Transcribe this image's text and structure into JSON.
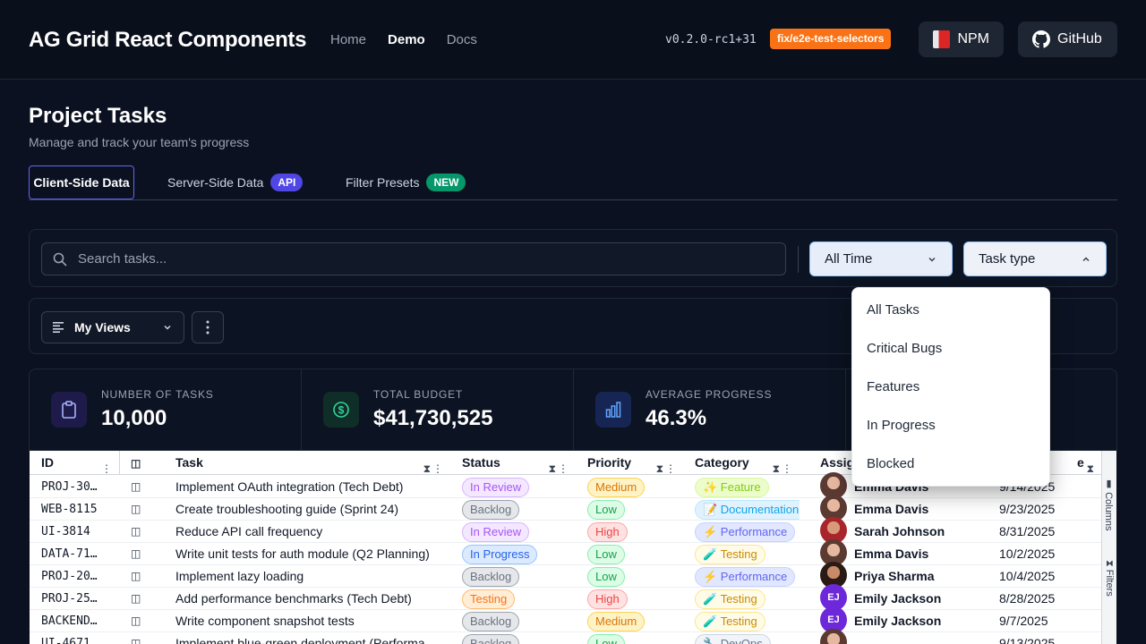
{
  "header": {
    "brand": "AG Grid React Components",
    "nav": [
      "Home",
      "Demo",
      "Docs"
    ],
    "version": "v0.2.0-rc1+31",
    "branch": "fix/e2e-test-selectors",
    "npm_label": "NPM",
    "github_label": "GitHub"
  },
  "page": {
    "title": "Project Tasks",
    "subtitle": "Manage and track your team's progress"
  },
  "tabs": {
    "client": "Client-Side Data",
    "server": "Server-Side Data",
    "server_badge": "API",
    "presets": "Filter Presets",
    "presets_badge": "NEW"
  },
  "filters": {
    "search_placeholder": "Search tasks...",
    "time_value": "All Time",
    "type_value": "Task type",
    "type_options": [
      "All Tasks",
      "Critical Bugs",
      "Features",
      "In Progress",
      "Blocked"
    ]
  },
  "views": {
    "label": "My Views"
  },
  "stats": [
    {
      "label": "NUMBER OF TASKS",
      "value": "10,000"
    },
    {
      "label": "TOTAL BUDGET",
      "value": "$41,730,525"
    },
    {
      "label": "AVERAGE PROGRESS",
      "value": "46.3%"
    }
  ],
  "grid": {
    "headers": {
      "id": "ID",
      "task": "Task",
      "status": "Status",
      "priority": "Priority",
      "category": "Category",
      "assignee": "Assig",
      "due": "e"
    },
    "side_columns": "Columns",
    "side_filters": "Filters",
    "rows": [
      {
        "id": "PROJ-30…",
        "task": "Implement OAuth integration (Tech Debt)",
        "status": "In Review",
        "priority": "Medium",
        "category": "✨ Feature",
        "assignee": "Emma Davis",
        "due": "9/14/2025"
      },
      {
        "id": "WEB-8115",
        "task": "Create troubleshooting guide (Sprint 24)",
        "status": "Backlog",
        "priority": "Low",
        "category": "📝 Documentation",
        "assignee": "Emma Davis",
        "due": "9/23/2025"
      },
      {
        "id": "UI-3814",
        "task": "Reduce API call frequency",
        "status": "In Review",
        "priority": "High",
        "category": "⚡ Performance",
        "assignee": "Sarah Johnson",
        "due": "8/31/2025"
      },
      {
        "id": "DATA-71…",
        "task": "Write unit tests for auth module (Q2 Planning)",
        "status": "In Progress",
        "priority": "Low",
        "category": "🧪 Testing",
        "assignee": "Emma Davis",
        "due": "10/2/2025"
      },
      {
        "id": "PROJ-20…",
        "task": "Implement lazy loading",
        "status": "Backlog",
        "priority": "Low",
        "category": "⚡ Performance",
        "assignee": "Priya Sharma",
        "due": "10/4/2025"
      },
      {
        "id": "PROJ-25…",
        "task": "Add performance benchmarks (Tech Debt)",
        "status": "Testing",
        "priority": "High",
        "category": "🧪 Testing",
        "assignee": "Emily Jackson",
        "due": "8/28/2025"
      },
      {
        "id": "BACKEND…",
        "task": "Write component snapshot tests",
        "status": "Backlog",
        "priority": "Medium",
        "category": "🧪 Testing",
        "assignee": "Emily Jackson",
        "due": "9/7/2025"
      },
      {
        "id": "UI-4671",
        "task": "Implement blue-green deployment (Performa",
        "status": "Backlog",
        "priority": "Low",
        "category": "🔧 DevOps",
        "assignee": "",
        "due": "9/13/2025"
      }
    ],
    "avatar_initials": "EJ"
  },
  "colors": {
    "accent": "#6366f1",
    "branch_badge": "#f97316",
    "api_badge": "#4f46e5",
    "new_badge": "#059669",
    "background": "#0b1120"
  }
}
